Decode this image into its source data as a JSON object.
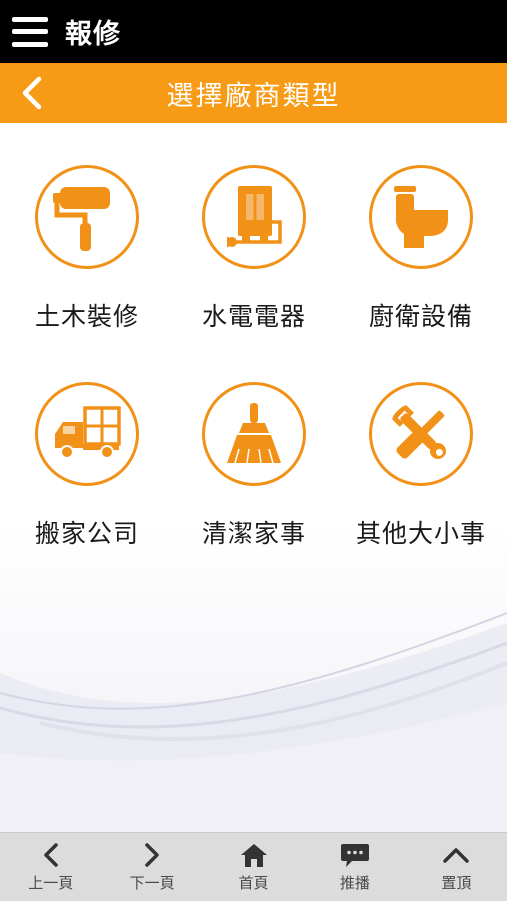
{
  "app_bar": {
    "title": "報修"
  },
  "title_bar": {
    "title": "選擇廠商類型"
  },
  "categories": [
    {
      "label": "土木裝修",
      "icon": "paint-roller-icon"
    },
    {
      "label": "水電電器",
      "icon": "water-heater-icon"
    },
    {
      "label": "廚衛設備",
      "icon": "toilet-icon"
    },
    {
      "label": "搬家公司",
      "icon": "moving-truck-icon"
    },
    {
      "label": "清潔家事",
      "icon": "broom-icon"
    },
    {
      "label": "其他大小事",
      "icon": "wrench-screwdriver-icon"
    }
  ],
  "bottom_nav": [
    {
      "label": "上一頁",
      "icon": "chevron-left-icon"
    },
    {
      "label": "下一頁",
      "icon": "chevron-right-icon"
    },
    {
      "label": "首頁",
      "icon": "home-icon"
    },
    {
      "label": "推播",
      "icon": "chat-bubble-icon"
    },
    {
      "label": "置頂",
      "icon": "chevron-up-icon"
    }
  ],
  "colors": {
    "accent": "#f79a16",
    "icon_orange": "#f29117",
    "app_bar_bg": "#000000",
    "bottom_bar_bg": "#dcdcdc"
  }
}
